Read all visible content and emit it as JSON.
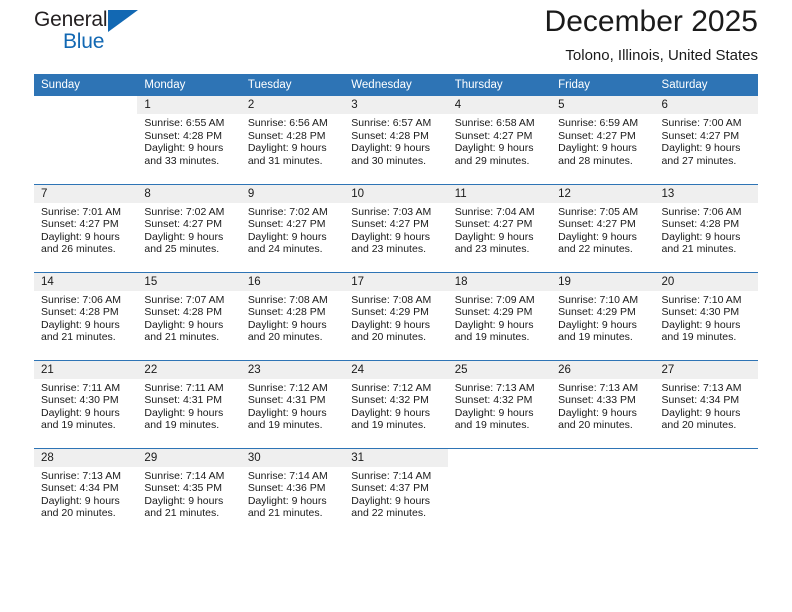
{
  "brand": {
    "name_part1": "General",
    "name_part2": "Blue",
    "triangle_icon": "triangle-icon",
    "accent_color": "#1268b3"
  },
  "header": {
    "title": "December 2025",
    "subtitle": "Tolono, Illinois, United States"
  },
  "theme": {
    "header_blue": "#2e74b5",
    "daynum_gray": "#efefef",
    "text": "#1a1a1a"
  },
  "weekdays": [
    "Sunday",
    "Monday",
    "Tuesday",
    "Wednesday",
    "Thursday",
    "Friday",
    "Saturday"
  ],
  "weeks": [
    [
      {
        "day": "",
        "sunrise": "",
        "sunset": "",
        "daylight": ""
      },
      {
        "day": "1",
        "sunrise": "Sunrise: 6:55 AM",
        "sunset": "Sunset: 4:28 PM",
        "daylight": "Daylight: 9 hours and 33 minutes."
      },
      {
        "day": "2",
        "sunrise": "Sunrise: 6:56 AM",
        "sunset": "Sunset: 4:28 PM",
        "daylight": "Daylight: 9 hours and 31 minutes."
      },
      {
        "day": "3",
        "sunrise": "Sunrise: 6:57 AM",
        "sunset": "Sunset: 4:28 PM",
        "daylight": "Daylight: 9 hours and 30 minutes."
      },
      {
        "day": "4",
        "sunrise": "Sunrise: 6:58 AM",
        "sunset": "Sunset: 4:27 PM",
        "daylight": "Daylight: 9 hours and 29 minutes."
      },
      {
        "day": "5",
        "sunrise": "Sunrise: 6:59 AM",
        "sunset": "Sunset: 4:27 PM",
        "daylight": "Daylight: 9 hours and 28 minutes."
      },
      {
        "day": "6",
        "sunrise": "Sunrise: 7:00 AM",
        "sunset": "Sunset: 4:27 PM",
        "daylight": "Daylight: 9 hours and 27 minutes."
      }
    ],
    [
      {
        "day": "7",
        "sunrise": "Sunrise: 7:01 AM",
        "sunset": "Sunset: 4:27 PM",
        "daylight": "Daylight: 9 hours and 26 minutes."
      },
      {
        "day": "8",
        "sunrise": "Sunrise: 7:02 AM",
        "sunset": "Sunset: 4:27 PM",
        "daylight": "Daylight: 9 hours and 25 minutes."
      },
      {
        "day": "9",
        "sunrise": "Sunrise: 7:02 AM",
        "sunset": "Sunset: 4:27 PM",
        "daylight": "Daylight: 9 hours and 24 minutes."
      },
      {
        "day": "10",
        "sunrise": "Sunrise: 7:03 AM",
        "sunset": "Sunset: 4:27 PM",
        "daylight": "Daylight: 9 hours and 23 minutes."
      },
      {
        "day": "11",
        "sunrise": "Sunrise: 7:04 AM",
        "sunset": "Sunset: 4:27 PM",
        "daylight": "Daylight: 9 hours and 23 minutes."
      },
      {
        "day": "12",
        "sunrise": "Sunrise: 7:05 AM",
        "sunset": "Sunset: 4:27 PM",
        "daylight": "Daylight: 9 hours and 22 minutes."
      },
      {
        "day": "13",
        "sunrise": "Sunrise: 7:06 AM",
        "sunset": "Sunset: 4:28 PM",
        "daylight": "Daylight: 9 hours and 21 minutes."
      }
    ],
    [
      {
        "day": "14",
        "sunrise": "Sunrise: 7:06 AM",
        "sunset": "Sunset: 4:28 PM",
        "daylight": "Daylight: 9 hours and 21 minutes."
      },
      {
        "day": "15",
        "sunrise": "Sunrise: 7:07 AM",
        "sunset": "Sunset: 4:28 PM",
        "daylight": "Daylight: 9 hours and 21 minutes."
      },
      {
        "day": "16",
        "sunrise": "Sunrise: 7:08 AM",
        "sunset": "Sunset: 4:28 PM",
        "daylight": "Daylight: 9 hours and 20 minutes."
      },
      {
        "day": "17",
        "sunrise": "Sunrise: 7:08 AM",
        "sunset": "Sunset: 4:29 PM",
        "daylight": "Daylight: 9 hours and 20 minutes."
      },
      {
        "day": "18",
        "sunrise": "Sunrise: 7:09 AM",
        "sunset": "Sunset: 4:29 PM",
        "daylight": "Daylight: 9 hours and 19 minutes."
      },
      {
        "day": "19",
        "sunrise": "Sunrise: 7:10 AM",
        "sunset": "Sunset: 4:29 PM",
        "daylight": "Daylight: 9 hours and 19 minutes."
      },
      {
        "day": "20",
        "sunrise": "Sunrise: 7:10 AM",
        "sunset": "Sunset: 4:30 PM",
        "daylight": "Daylight: 9 hours and 19 minutes."
      }
    ],
    [
      {
        "day": "21",
        "sunrise": "Sunrise: 7:11 AM",
        "sunset": "Sunset: 4:30 PM",
        "daylight": "Daylight: 9 hours and 19 minutes."
      },
      {
        "day": "22",
        "sunrise": "Sunrise: 7:11 AM",
        "sunset": "Sunset: 4:31 PM",
        "daylight": "Daylight: 9 hours and 19 minutes."
      },
      {
        "day": "23",
        "sunrise": "Sunrise: 7:12 AM",
        "sunset": "Sunset: 4:31 PM",
        "daylight": "Daylight: 9 hours and 19 minutes."
      },
      {
        "day": "24",
        "sunrise": "Sunrise: 7:12 AM",
        "sunset": "Sunset: 4:32 PM",
        "daylight": "Daylight: 9 hours and 19 minutes."
      },
      {
        "day": "25",
        "sunrise": "Sunrise: 7:13 AM",
        "sunset": "Sunset: 4:32 PM",
        "daylight": "Daylight: 9 hours and 19 minutes."
      },
      {
        "day": "26",
        "sunrise": "Sunrise: 7:13 AM",
        "sunset": "Sunset: 4:33 PM",
        "daylight": "Daylight: 9 hours and 20 minutes."
      },
      {
        "day": "27",
        "sunrise": "Sunrise: 7:13 AM",
        "sunset": "Sunset: 4:34 PM",
        "daylight": "Daylight: 9 hours and 20 minutes."
      }
    ],
    [
      {
        "day": "28",
        "sunrise": "Sunrise: 7:13 AM",
        "sunset": "Sunset: 4:34 PM",
        "daylight": "Daylight: 9 hours and 20 minutes."
      },
      {
        "day": "29",
        "sunrise": "Sunrise: 7:14 AM",
        "sunset": "Sunset: 4:35 PM",
        "daylight": "Daylight: 9 hours and 21 minutes."
      },
      {
        "day": "30",
        "sunrise": "Sunrise: 7:14 AM",
        "sunset": "Sunset: 4:36 PM",
        "daylight": "Daylight: 9 hours and 21 minutes."
      },
      {
        "day": "31",
        "sunrise": "Sunrise: 7:14 AM",
        "sunset": "Sunset: 4:37 PM",
        "daylight": "Daylight: 9 hours and 22 minutes."
      },
      {
        "day": "",
        "sunrise": "",
        "sunset": "",
        "daylight": ""
      },
      {
        "day": "",
        "sunrise": "",
        "sunset": "",
        "daylight": ""
      },
      {
        "day": "",
        "sunrise": "",
        "sunset": "",
        "daylight": ""
      }
    ]
  ]
}
